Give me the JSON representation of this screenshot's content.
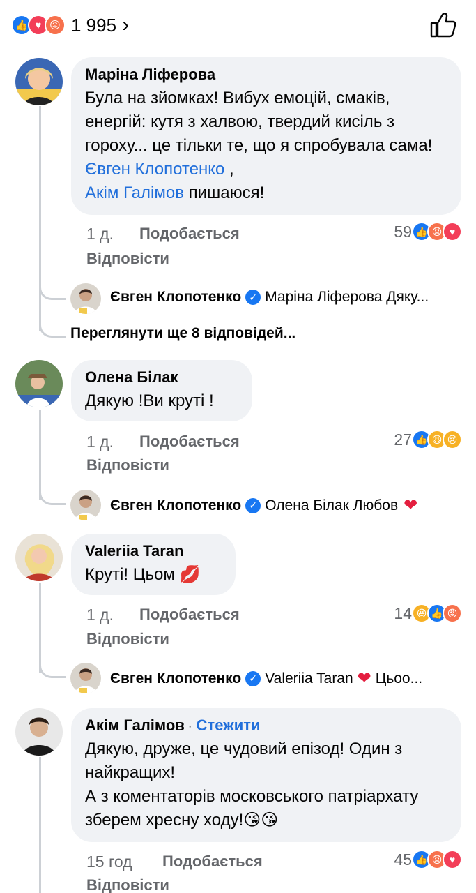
{
  "summary": {
    "reaction_icons": [
      "like-icon",
      "love-icon",
      "angry-icon"
    ],
    "count": "1 995",
    "chevron": "›"
  },
  "comments": [
    {
      "author": "Маріна Ліферова",
      "text_before": "Була на зйомках! Вибух емоцій, смаків, енергій: кутя з халвою, твердий кисіль з гороху...  це тільки те, що я спробувала сама! ",
      "mention1": "Євген Клопотенко",
      "text_mid": " ,",
      "mention2": "Акім Галімов",
      "text_after": "  пишаюся!",
      "time": "1 д.",
      "like": "Подобається",
      "reply": "Відповісти",
      "react_count": "59",
      "reaction_icons": [
        "like-icon",
        "angry-icon",
        "love-icon"
      ],
      "reply_preview": {
        "name": "Євген Клопотенко",
        "text": "Маріна Ліферова Дяку..."
      },
      "more_replies": "Переглянути ще 8 відповідей..."
    },
    {
      "author": "Олена Білак",
      "text": "Дякую !Ви круті !",
      "time": "1 д.",
      "like": "Подобається",
      "reply": "Відповісти",
      "react_count": "27",
      "reaction_icons": [
        "like-icon",
        "haha-icon",
        "sad-icon"
      ],
      "reply_preview": {
        "name": "Євген Клопотенко",
        "text": "Олена Білак Любов"
      }
    },
    {
      "author": "Valeriia Taran",
      "text": "Круті! Цьом",
      "time": "1 д.",
      "like": "Подобається",
      "reply": "Відповісти",
      "react_count": "14",
      "reaction_icons": [
        "haha-icon",
        "like-icon",
        "angry-icon"
      ],
      "reply_preview": {
        "name": "Євген Клопотенко",
        "text_before": "Valeriia Taran",
        "text_after": "Цьоо..."
      }
    },
    {
      "author": "Акім Галімов",
      "follow": "Стежити",
      "text": "Дякую, друже, це чудовий епізод! Один з найкращих!\nА з коментаторів московського патріархату зберем хресну ходу!",
      "time": "15 год",
      "like": "Подобається",
      "reply": "Відповісти",
      "react_count": "45",
      "reaction_icons": [
        "like-icon",
        "angry-icon",
        "love-icon"
      ]
    }
  ],
  "colors": {
    "like": "#1877f2",
    "love": "#f33e58",
    "angry": "#f7714c",
    "haha": "#f7b125",
    "mention": "#216fdb",
    "bubble": "#f0f2f5",
    "meta": "#65676b"
  }
}
